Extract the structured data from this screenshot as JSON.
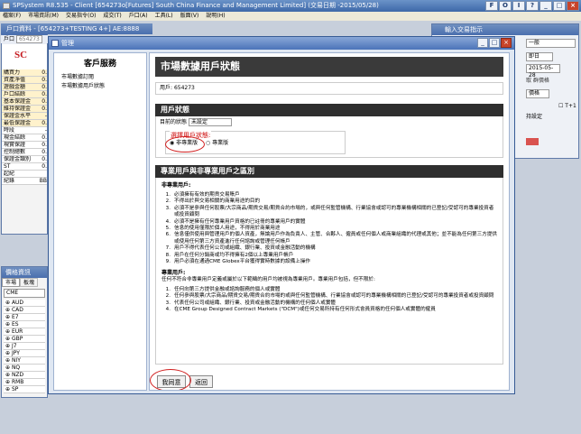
{
  "app": {
    "title": "SPSystem R8.535 - Client [654273o[Futures] South China Finance and Management Limited] (交易日期 -2015/05/28)"
  },
  "app_buttons": [
    "F",
    "O",
    "I",
    "?"
  ],
  "menu": [
    "檔案(F)",
    "市場資訊(M)",
    "交易指令(O)",
    "成交(T)",
    "戶口(A)",
    "工具(L)",
    "版面(V)",
    "說明(H)"
  ],
  "account_window": {
    "title": "戶口資料 - [654273+TESTING 4+] AE:8888",
    "label_account": "戶口",
    "account_value": "654273",
    "logo": "SC"
  },
  "account_rows": [
    "購買力",
    "資產淨值",
    "遊戲金額",
    "戶口結餘",
    "基本保證金",
    "維持保證金",
    "保證金水平",
    "最低保證金",
    "時段",
    "現金結餘",
    "現實保證",
    "控制總數",
    "保證金類別",
    "ST",
    "起紀",
    "紀錄"
  ],
  "account_values": [
    "0.",
    "0.",
    "0.",
    "0.",
    "0.",
    "0.",
    "-",
    "0.",
    "-",
    "0.",
    "0.",
    "0.",
    "0.",
    "0.",
    "",
    "BB"
  ],
  "order_window": {
    "title": "輸入交易指示",
    "field_one": "一般",
    "field_today": "即日",
    "field_date": "2015-05-28",
    "field_price": "價格",
    "check_label": "T+1",
    "hold_label": "持設定",
    "note": "取 群價格"
  },
  "price_window": {
    "title": "價格資訊",
    "tab_market": "市場",
    "tab_board": "板塊",
    "selected": "CME",
    "items": [
      "AUD",
      "CAD",
      "E7",
      "ES",
      "EUR",
      "GBP",
      "J7",
      "JPY",
      "NIY",
      "NQ",
      "NZD",
      "RMB",
      "SP"
    ]
  },
  "dialog": {
    "title": "管理"
  },
  "sidebar": {
    "heading": "客戶服務",
    "links": [
      "市場數據訂閱",
      "市場數據用戶狀態"
    ]
  },
  "main": {
    "heading": "市場數據用戶狀態",
    "user_label": "用戶:",
    "user_id": "654273",
    "status_section": "用戶狀態",
    "current_status_label": "目前的狀態",
    "current_status_value": "未設定",
    "choose_label": "選擇用戶狀態:",
    "option_non_pro": "非專業版",
    "option_pro": "專業版",
    "diff_section": "專業用戶與非專業用戶之區別",
    "non_pro_title": "非專業用戶:",
    "non_pro_items": [
      "必須擁有有效的期貨交易賬戶",
      "不得出於與交易相關的商業用途的目的",
      "必須不是參與任何股票/大宗商品/期貨交易/期貨合約市場的，或與任何監管機構、行業協會或認可的專業機構相關的已登記/受認可的專業投資者或投資顧問",
      "必須不是擁有任何專業用戶資格的已註冊的專業用戶的實體",
      "信息的使用僅限於個人用途，不得用於商業用途",
      "信息僅供使用與管理用戶的個人資產，無論用戶作為負責人、主管、合夥人、僱員或任何個人或商業組織的代理或其他；並不能為任何第三方提供或使用任何第三方資產進行任何諮詢或管理任何帳戶",
      "用戶不得代表任何公司或組織、銀行業、投資或金融活動的機構",
      "用戶在任何分銷商或均不得擁有2個以上專業用戶帳戶",
      "用戶必須在通過CME Globex平台獲得實時數據的設備上操作"
    ],
    "pro_title": "專業用戶:",
    "pro_desc": "任何不符合非專業用戶定義或屬於以下範疇的用戶均被視為專業用戶。專業用戶包括，但不限於:",
    "pro_items": [
      "任何向第三方提供金融或諮詢服務的個人或實體",
      "任何參與股票/大宗商品/期貨交易/期貨合約市場的或與任何監管機構、行業協會或認可的專業機構相關的已登記/受認可的專業投資者或投資顧問",
      "代表任何公司或組織、銀行業、投資或金融活動的機構的任何個人或實體",
      "在CME Group Designed Contract Markets (\"DCM\")或任何交易所持有任何形式會員資格的任何個人或實體的僱員"
    ],
    "agree_button": "我同意",
    "cancel_button": "返回"
  }
}
